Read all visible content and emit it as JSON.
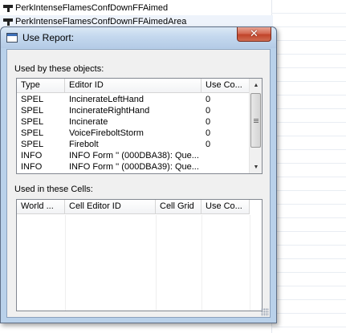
{
  "background_list": {
    "items": [
      {
        "label": "PerkIntenseFlamesConfDownFFAimed"
      },
      {
        "label": "PerkIntenseFlamesConfDownFFAimedArea"
      }
    ]
  },
  "dialog": {
    "title": "Use Report:",
    "close_label": "✕",
    "objects_section": {
      "label": "Used by these objects:",
      "columns": [
        "Type",
        "Editor ID",
        "Use Co..."
      ],
      "rows": [
        {
          "type": "SPEL",
          "editor_id": "IncinerateLeftHand",
          "use_count": "0"
        },
        {
          "type": "SPEL",
          "editor_id": "IncinerateRightHand",
          "use_count": "0"
        },
        {
          "type": "SPEL",
          "editor_id": "Incinerate",
          "use_count": "0"
        },
        {
          "type": "SPEL",
          "editor_id": "VoiceFireboltStorm",
          "use_count": "0"
        },
        {
          "type": "SPEL",
          "editor_id": "Firebolt",
          "use_count": "0"
        },
        {
          "type": "INFO",
          "editor_id": "INFO Form '' (000DBA38): Que...",
          "use_count": ""
        },
        {
          "type": "INFO",
          "editor_id": "INFO Form '' (000DBA39): Que...",
          "use_count": ""
        }
      ]
    },
    "cells_section": {
      "label": "Used in these Cells:",
      "columns": [
        "World ...",
        "Cell Editor ID",
        "Cell Grid",
        "Use Co..."
      ],
      "rows": []
    }
  }
}
